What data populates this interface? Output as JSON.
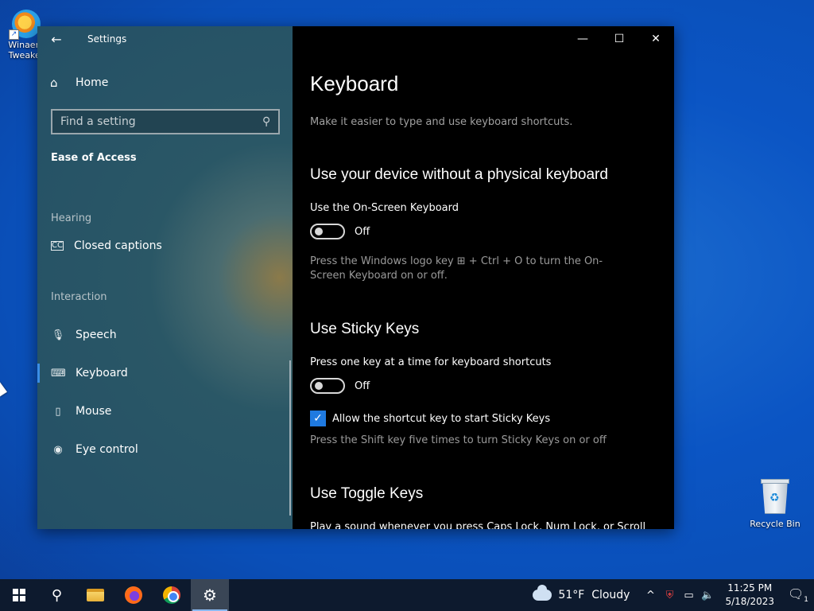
{
  "desktop": {
    "icons": [
      {
        "label": "Winaero Tweaker"
      },
      {
        "label": "Recycle Bin"
      }
    ]
  },
  "window": {
    "title": "Settings",
    "controls": {
      "minimize": "—",
      "maximize": "☐",
      "close": "✕"
    }
  },
  "nav": {
    "back_glyph": "←",
    "home": "Home",
    "search_placeholder": "Find a setting",
    "section": "Ease of Access",
    "groups": [
      "Hearing",
      "Interaction"
    ],
    "items": [
      {
        "label": "Closed captions",
        "icon": "closed-captions-icon"
      },
      {
        "label": "Speech",
        "icon": "microphone-icon"
      },
      {
        "label": "Keyboard",
        "icon": "keyboard-icon",
        "selected": true
      },
      {
        "label": "Mouse",
        "icon": "mouse-icon"
      },
      {
        "label": "Eye control",
        "icon": "eye-control-icon"
      }
    ]
  },
  "content": {
    "title": "Keyboard",
    "description": "Make it easier to type and use keyboard shortcuts.",
    "osk": {
      "heading": "Use your device without a physical keyboard",
      "label": "Use the On-Screen Keyboard",
      "state": "Off",
      "hint": "Press the Windows logo key ⊞ + Ctrl + O to turn the On-Screen Keyboard on or off."
    },
    "sticky": {
      "heading": "Use Sticky Keys",
      "label": "Press one key at a time for keyboard shortcuts",
      "state": "Off",
      "checkbox_label": "Allow the shortcut key to start Sticky Keys",
      "checkbox_checked": true,
      "hint": "Press the Shift key five times to turn Sticky Keys on or off"
    },
    "toggle_keys": {
      "heading": "Use Toggle Keys",
      "partial_text": "Play a sound whenever you press Caps Lock, Num Lock, or Scroll"
    }
  },
  "taskbar": {
    "weather": {
      "temp": "51°F",
      "condition": "Cloudy"
    },
    "time": "11:25 PM",
    "date": "5/18/2023",
    "notification_count": "1"
  },
  "colors": {
    "accent": "#1f7ae0",
    "content_bg": "#000000",
    "taskbar_bg": "#0d1a2e"
  }
}
